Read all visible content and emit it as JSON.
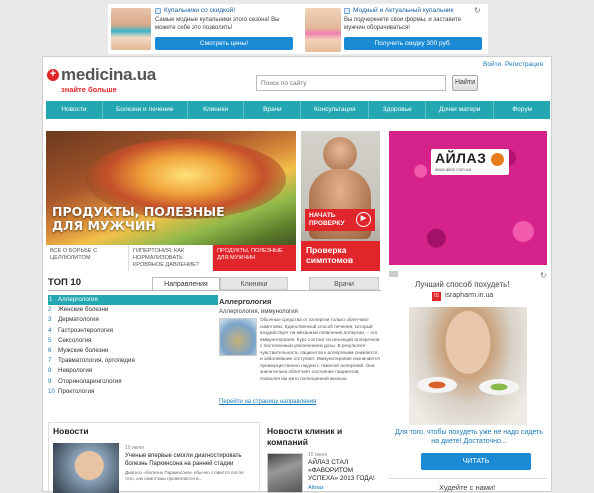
{
  "top_ads": [
    {
      "title": "Купальники со скидкой!",
      "text": "Самые модные купальники этого сезона! Вы можете себе это позволить!",
      "button": "Смотреть цены!"
    },
    {
      "title": "Модный и Актуальный купальник",
      "text": "Вы подчеркнете свои формы, и заставите мужчин оборачиваться!",
      "button": "Получить скидку 300 руб."
    }
  ],
  "header": {
    "logo": "medicina.ua",
    "tagline": "знайте больше",
    "login": "Войти",
    "register": "Регистрация",
    "search_placeholder": "Поиск по сайту",
    "search_button": "Найти"
  },
  "nav": [
    "Новости",
    "Болезни и лечение",
    "Клиники",
    "Врачи",
    "Консультация",
    "Здоровье",
    "Дочки матери",
    "Форум"
  ],
  "hero": {
    "headline_line1": "ПРОДУКТЫ, ПОЛЕЗНЫЕ",
    "headline_line2": "ДЛЯ МУЖЧИН",
    "captions": [
      "ВСЕ О БОРЬБЕ С ЦЕЛЛЮЛИТОМ",
      "ГИПЕРТОНИЯ: КАК НОРМАЛИЗОВАТЬ КРОВЯНОЕ ДАВЛЕНИЕ?",
      "ПРОДУКТЫ, ПОЛЕЗНЫЕ ДЛЯ МУЖЧИН"
    ],
    "side_button": "НАЧАТЬ ПРОВЕРКУ",
    "side_caption": "Проверка симптомов"
  },
  "banner": {
    "brand": "АЙЛАЗ",
    "url": "www.ailaz.com.ua"
  },
  "top10": {
    "title": "ТОП 10",
    "tabs": [
      "Направления",
      "Клиники",
      "Врачи"
    ],
    "items": [
      "Аллергология",
      "Женские болезни",
      "Дерматология",
      "Гастроэнтерология",
      "Сексология",
      "Мужские болезни",
      "Травматология, ортопедия",
      "Неврология",
      "Оториноларингология",
      "Проктология"
    ],
    "detail_title": "Аллергология",
    "detail_subtitle": "Аллергология, иммунология",
    "detail_text": "Обычные средства от аллергии только облегчают симптомы. Единственный способ лечения, который воздействует на механизм появления аллергии, – это иммунотерапия. Курс состоит из инъекций аллергенов с постепенным увеличением дозы. В результате чувствительность пациентов к аллергенам снижается, и заболевание отступает. Иммунотерапия назначается преимущественно людям с тяжелой аллергией. Она значительно облегчает состояние пациентов, позволяя им жить полноценной жизнью.",
    "detail_link": "Перейти на страницу направления"
  },
  "side_ad": {
    "title": "Лучший способ похудеть!",
    "domain": "israpharm.in.ua",
    "text": "Для того, чтобы похудеть уже не надо сидеть на диете! Достаточно...",
    "button": "ЧИТАТЬ",
    "bottom_title": "Худейте с нами!"
  },
  "news": {
    "title": "Новости",
    "date": "10 июня",
    "headline": "Ученые впервые смогли диагностировать болезнь Паркинсона на ранней стадии",
    "text": "Диагноз «болезнь Паркинсона» обычно ставится после того, как симптомы проявляются в..."
  },
  "clinic_news": {
    "title_line1": "Новости клиник и",
    "title_line2": "компаний",
    "date": "10 июня",
    "headline": "АЙЛАЗ СТАЛ «ФАВОРИТОМ УСПЕХА» 2013 ГОДА!",
    "company": "Айлаз"
  },
  "colors": {
    "teal": "#23a7b1",
    "red": "#e0262b",
    "link": "#1a7ab8"
  }
}
